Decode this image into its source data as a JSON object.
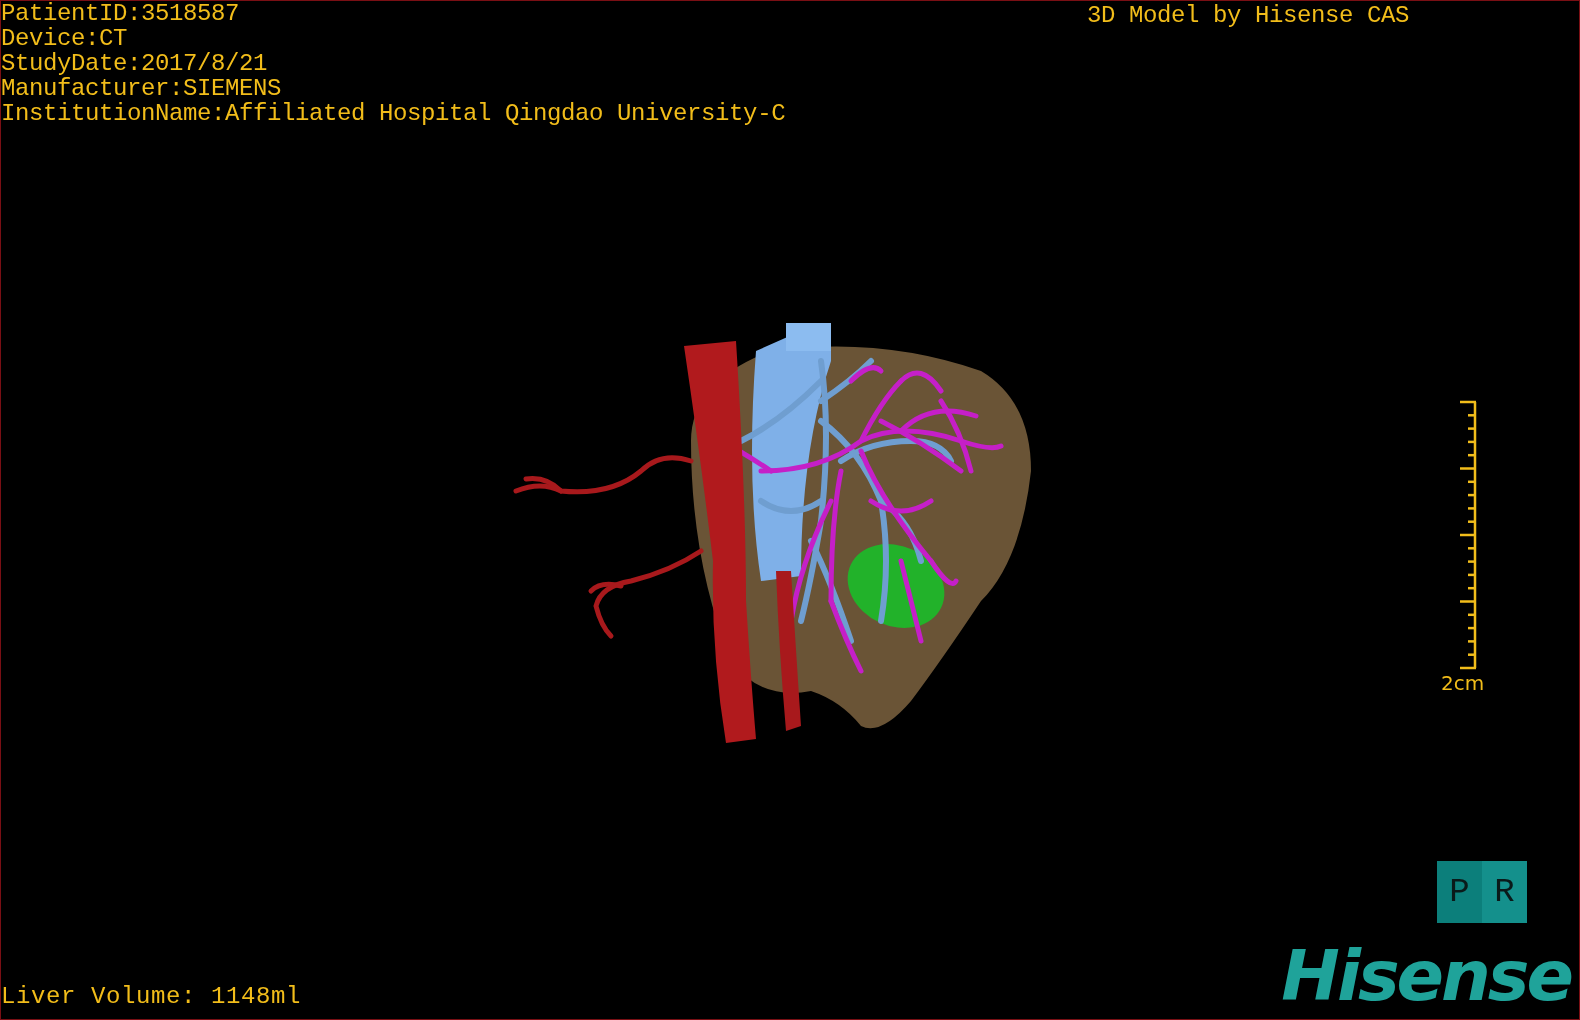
{
  "patient_info": [
    "PatientID:3518587",
    "Device:CT",
    "StudyDate:2017/8/21",
    "Manufacturer:SIEMENS",
    "InstitutionName:Affiliated Hospital Qingdao University-C"
  ],
  "title": "3D Model by Hisense CAS",
  "scale_bar": {
    "label": "2cm"
  },
  "orientation_cube": {
    "faces": [
      {
        "label": "P"
      },
      {
        "label": "R"
      }
    ]
  },
  "logo": "Hisense",
  "liver_volume": "Liver Volume: 1148ml"
}
